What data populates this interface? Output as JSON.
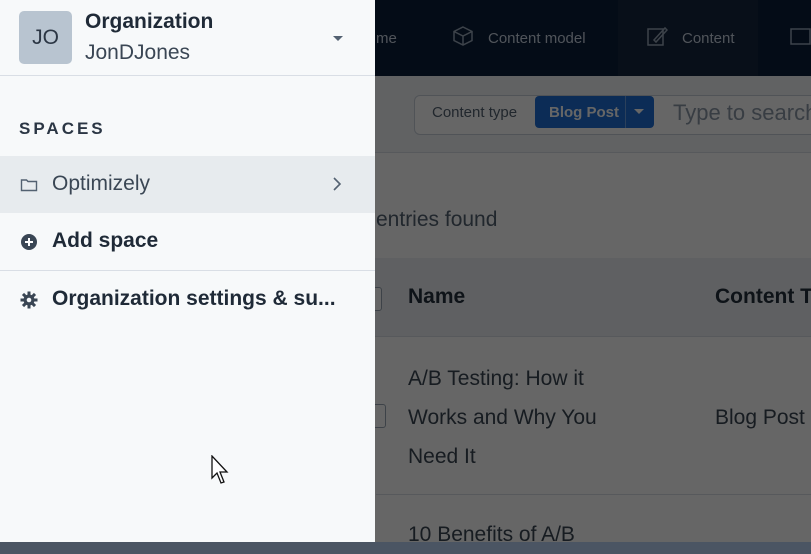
{
  "nav": {
    "items": [
      {
        "label": "me",
        "icon": "home-icon"
      },
      {
        "label": "Content model",
        "icon": "content-model-icon"
      },
      {
        "label": "Content",
        "icon": "content-icon"
      },
      {
        "label": "",
        "icon": "media-icon"
      }
    ]
  },
  "filter": {
    "content_type_label": "Content type",
    "content_type_value": "Blog Post",
    "search_placeholder": "Type to search"
  },
  "list": {
    "entries_found": "entries found",
    "columns": [
      "Name",
      "Content T"
    ],
    "rows": [
      {
        "name": "A/B Testing: How it Works and Why You Need It",
        "content_type": "Blog Post"
      },
      {
        "name": "10 Benefits of A/B",
        "content_type": ""
      }
    ]
  },
  "panel": {
    "avatar_initials": "JO",
    "org_title": "Organization",
    "org_name": "JonDJones",
    "spaces_label": "SPACES",
    "items": [
      {
        "label": "Optimizely",
        "icon": "folder-icon"
      },
      {
        "label": "Add space",
        "icon": "plus-circle-icon"
      },
      {
        "label": "Organization settings & su...",
        "icon": "gear-icon"
      }
    ]
  },
  "colors": {
    "nav_bg": "#0b1f3a",
    "accent": "#1f6fd6",
    "panel_bg": "#f7f9fa",
    "active_item_bg": "#e7ebee"
  }
}
